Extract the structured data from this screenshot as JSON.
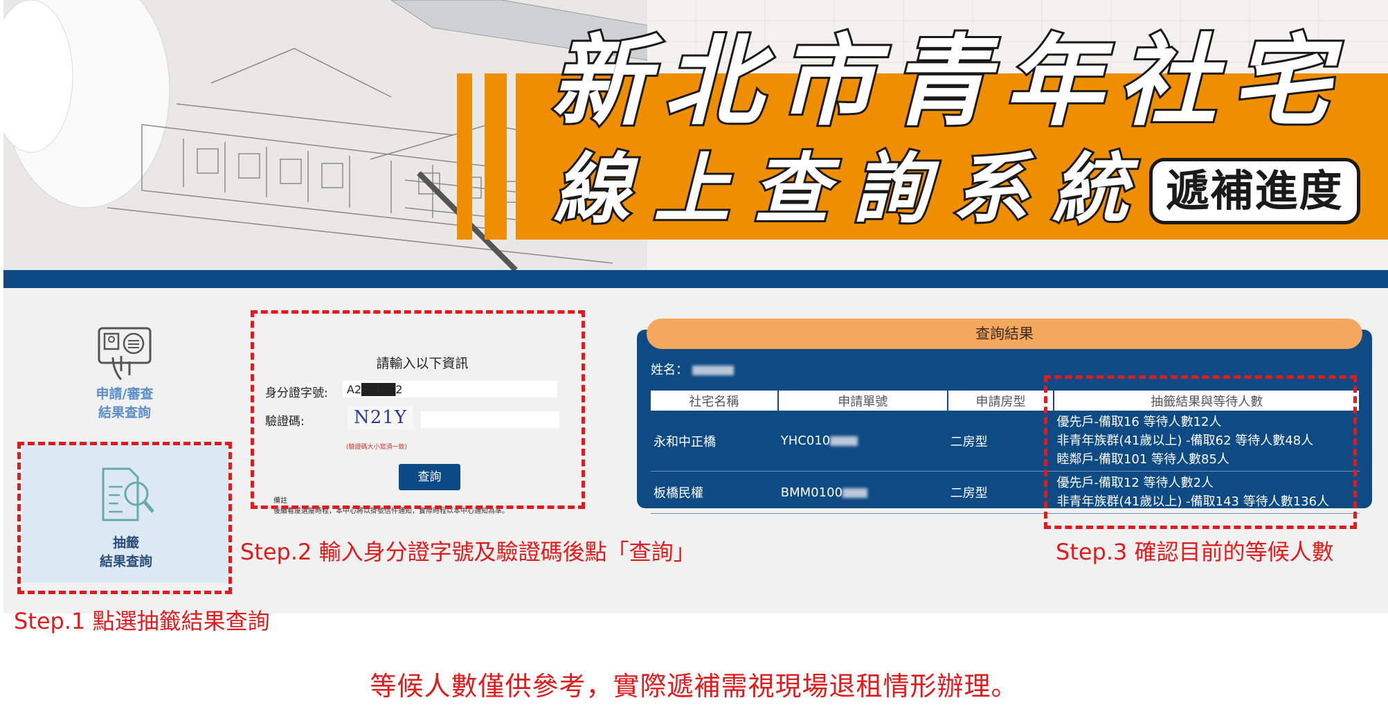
{
  "banner": {
    "title_line1": "新北市青年社宅",
    "title_line2": "線上查詢系統",
    "badge": "遞補進度"
  },
  "sidebar": {
    "items": [
      {
        "label_line1": "申請/審查",
        "label_line2": "結果查詢",
        "icon": "id-card-fingerprint-icon"
      },
      {
        "label_line1": "抽籤",
        "label_line2": "結果查詢",
        "icon": "document-search-icon"
      }
    ]
  },
  "form": {
    "title": "請輸入以下資訊",
    "id_label": "身分證字號:",
    "id_value": "A2████2",
    "captcha_label": "驗證碼:",
    "captcha_text": "N21Y",
    "captcha_note": "(驗證碼大小寫須一致)",
    "query_button": "查詢",
    "notes_title": "備註",
    "notes_text": "後續看屋選屋時程，本中心將以掛號信件通知，實際時程以本中心通知為準。"
  },
  "result": {
    "header": "查詢結果",
    "name_label": "姓名：",
    "columns": [
      "社宅名稱",
      "申請單號",
      "申請房型",
      "抽籤結果與等待人數"
    ],
    "rows": [
      {
        "name": "永和中正橋",
        "app_no": "YHC010",
        "room": "二房型",
        "results": [
          "優先戶-備取16 等待人數12人",
          "非青年族群(41歲以上) -備取62 等待人數48人",
          "睦鄰戶-備取101 等待人數85人"
        ]
      },
      {
        "name": "板橋民權",
        "app_no": "BMM0100",
        "room": "二房型",
        "results": [
          "優先戶-備取12 等待人數2人",
          "非青年族群(41歲以上) -備取143 等待人數136人"
        ]
      }
    ]
  },
  "steps": {
    "step1": "Step.1 點選抽籤結果查詢",
    "step2": "Step.2 輸入身分證字號及驗證碼後點「查詢」",
    "step3": "Step.3 確認目前的等候人數"
  },
  "footer": "等候人數僅供參考，實際遞補需視現場退租情形辦理。",
  "colors": {
    "orange": "#ee8e00",
    "navy": "#0c4a86",
    "annotation_red": "#e11b1b"
  }
}
